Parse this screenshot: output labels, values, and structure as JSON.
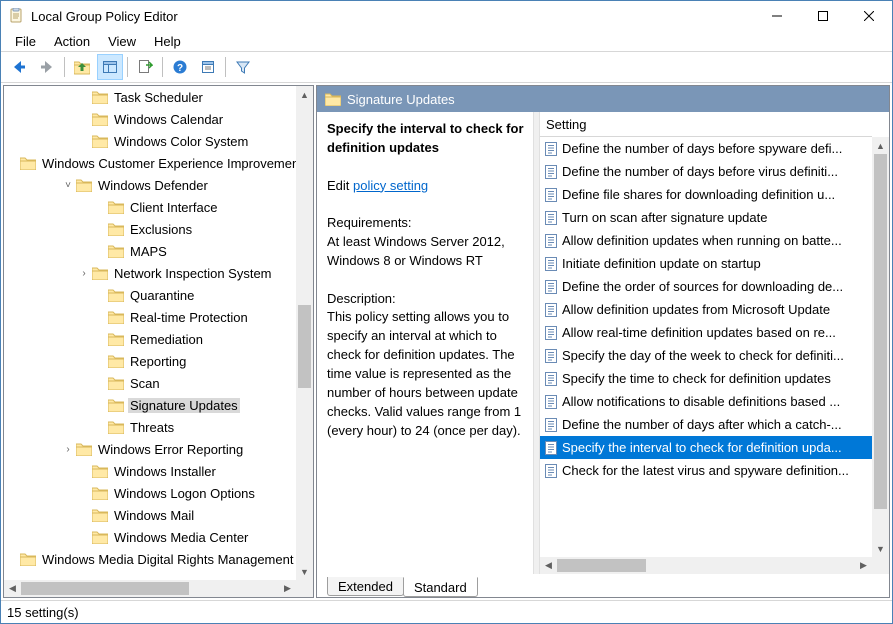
{
  "window": {
    "title": "Local Group Policy Editor"
  },
  "menu": {
    "file": "File",
    "action": "Action",
    "view": "View",
    "help": "Help"
  },
  "status": {
    "text": "15 setting(s)"
  },
  "header": {
    "title": "Signature Updates"
  },
  "detail": {
    "title": "Specify the interval to check for definition updates",
    "edit_prefix": "Edit ",
    "edit_link": "policy setting ",
    "req_label": "Requirements:",
    "req_text": "At least Windows Server 2012, Windows 8 or Windows RT",
    "desc_label": "Description:",
    "desc_text": "This policy setting allows you to specify an interval at which to check for definition updates. The time value is represented as the number of hours between update checks. Valid values range from 1 (every hour) to 24 (once per day)."
  },
  "listhead": {
    "setting": "Setting"
  },
  "tabs": {
    "extended": "Extended",
    "standard": "Standard"
  },
  "tree": [
    {
      "indent": 72,
      "exp": "",
      "label": "Task Scheduler"
    },
    {
      "indent": 72,
      "exp": "",
      "label": "Windows Calendar"
    },
    {
      "indent": 72,
      "exp": "",
      "label": "Windows Color System"
    },
    {
      "indent": 72,
      "exp": "",
      "label": "Windows Customer Experience Improvement Program"
    },
    {
      "indent": 56,
      "exp": "v",
      "label": "Windows Defender"
    },
    {
      "indent": 88,
      "exp": "",
      "label": "Client Interface"
    },
    {
      "indent": 88,
      "exp": "",
      "label": "Exclusions"
    },
    {
      "indent": 88,
      "exp": "",
      "label": "MAPS"
    },
    {
      "indent": 72,
      "exp": ">",
      "label": "Network Inspection System"
    },
    {
      "indent": 88,
      "exp": "",
      "label": "Quarantine"
    },
    {
      "indent": 88,
      "exp": "",
      "label": "Real-time Protection"
    },
    {
      "indent": 88,
      "exp": "",
      "label": "Remediation"
    },
    {
      "indent": 88,
      "exp": "",
      "label": "Reporting"
    },
    {
      "indent": 88,
      "exp": "",
      "label": "Scan"
    },
    {
      "indent": 88,
      "exp": "",
      "label": "Signature Updates",
      "selected": true
    },
    {
      "indent": 88,
      "exp": "",
      "label": "Threats"
    },
    {
      "indent": 56,
      "exp": ">",
      "label": "Windows Error Reporting"
    },
    {
      "indent": 72,
      "exp": "",
      "label": "Windows Installer"
    },
    {
      "indent": 72,
      "exp": "",
      "label": "Windows Logon Options"
    },
    {
      "indent": 72,
      "exp": "",
      "label": "Windows Mail"
    },
    {
      "indent": 72,
      "exp": "",
      "label": "Windows Media Center"
    },
    {
      "indent": 72,
      "exp": "",
      "label": "Windows Media Digital Rights Management"
    }
  ],
  "settings": [
    {
      "label": "Define the number of days before spyware defi..."
    },
    {
      "label": "Define the number of days before virus definiti..."
    },
    {
      "label": "Define file shares for downloading definition u..."
    },
    {
      "label": "Turn on scan after signature update"
    },
    {
      "label": "Allow definition updates when running on batte..."
    },
    {
      "label": "Initiate definition update on startup"
    },
    {
      "label": "Define the order of sources for downloading de..."
    },
    {
      "label": "Allow definition updates from Microsoft Update"
    },
    {
      "label": "Allow real-time definition updates based on re..."
    },
    {
      "label": "Specify the day of the week to check for definiti..."
    },
    {
      "label": "Specify the time to check for definition updates"
    },
    {
      "label": "Allow notifications to disable definitions based ..."
    },
    {
      "label": "Define the number of days after which a catch-..."
    },
    {
      "label": "Specify the interval to check for definition upda...",
      "selected": true
    },
    {
      "label": "Check for the latest virus and spyware definition..."
    }
  ]
}
